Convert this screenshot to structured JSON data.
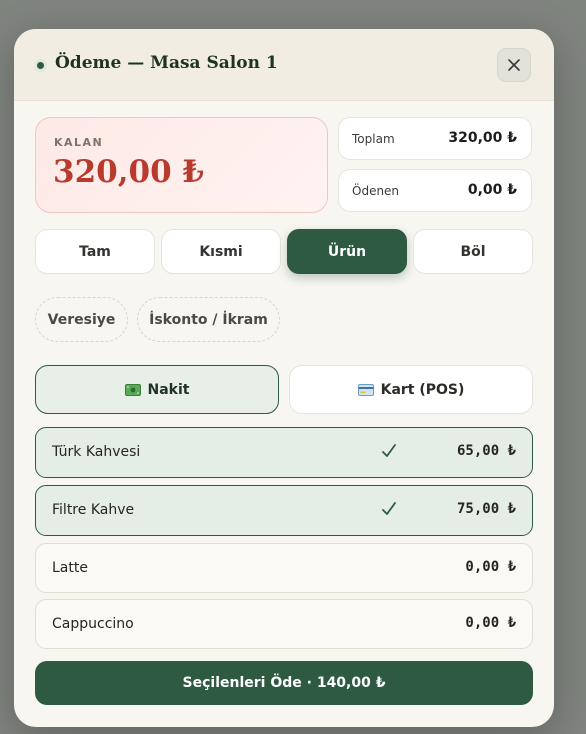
{
  "header": {
    "title": "Ödeme — Masa Salon 1",
    "close_icon": "close-icon"
  },
  "summary": {
    "remaining_label": "KALAN",
    "remaining_value": "320,00 ₺",
    "total_label": "Toplam",
    "total_value": "320,00 ₺",
    "paid_label": "Ödenen",
    "paid_value": "0,00 ₺"
  },
  "payment_types": [
    {
      "label": "Tam",
      "active": false
    },
    {
      "label": "Kısmi",
      "active": false
    },
    {
      "label": "Ürün",
      "active": true
    },
    {
      "label": "Böl",
      "active": false
    }
  ],
  "extras": {
    "credit_label": "Veresiye",
    "discount_label": "İskonto / İkram"
  },
  "methods": {
    "cash": {
      "label": "Nakit",
      "icon": "banknote-icon",
      "active": true
    },
    "card": {
      "label": "Kart (POS)",
      "icon": "credit-card-icon",
      "active": false
    }
  },
  "items": [
    {
      "name": "Türk Kahvesi",
      "price": "65,00 ₺",
      "selected": true
    },
    {
      "name": "Filtre Kahve",
      "price": "75,00 ₺",
      "selected": true
    },
    {
      "name": "Latte",
      "price": "0,00 ₺",
      "selected": false
    },
    {
      "name": "Cappuccino",
      "price": "0,00 ₺",
      "selected": false
    }
  ],
  "pay_button": {
    "label": "Seçilenleri Öde · 140,00 ₺"
  },
  "colors": {
    "primary": "#2d5a40",
    "remaining": "#b83a2e",
    "overlay": "#80847f"
  }
}
